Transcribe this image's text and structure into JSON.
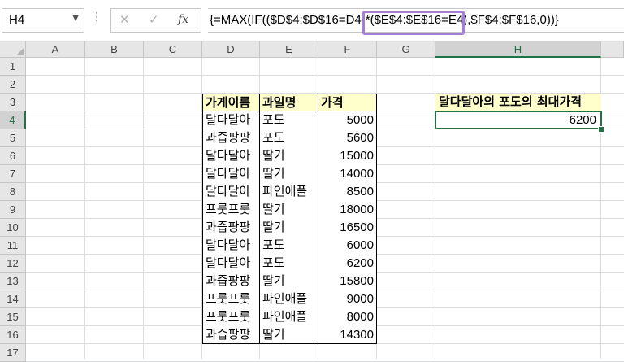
{
  "name_box": "H4",
  "formula_bar": {
    "dots": "⋮",
    "cancel_glyph": "✕",
    "enter_glyph": "✓",
    "fx_glyph": "fx",
    "formula": "{=MAX(IF(($D$4:$D$16=D4)*($E$4:$E$16=E4),$F$4:$F$16,0))}"
  },
  "columns": [
    "A",
    "B",
    "C",
    "D",
    "E",
    "F",
    "G",
    "H"
  ],
  "rows": [
    "1",
    "2",
    "3",
    "4",
    "5",
    "6",
    "7",
    "8",
    "9",
    "10",
    "11",
    "12",
    "13",
    "14",
    "15",
    "16",
    "17"
  ],
  "selected_cell": "H4",
  "table": {
    "headers": [
      "가게이름",
      "과일명",
      "가격"
    ],
    "rows": [
      [
        "달다달아",
        "포도",
        "5000"
      ],
      [
        "과즙팡팡",
        "포도",
        "5600"
      ],
      [
        "달다달아",
        "딸기",
        "15000"
      ],
      [
        "달다달아",
        "딸기",
        "14000"
      ],
      [
        "달다달아",
        "파인애플",
        "8500"
      ],
      [
        "프룻프룻",
        "딸기",
        "18000"
      ],
      [
        "과즙팡팡",
        "딸기",
        "16500"
      ],
      [
        "달다달아",
        "포도",
        "6000"
      ],
      [
        "달다달아",
        "포도",
        "6200"
      ],
      [
        "과즙팡팡",
        "딸기",
        "15800"
      ],
      [
        "프룻프룻",
        "파인애플",
        "9000"
      ],
      [
        "프룻프룻",
        "파인애플",
        "8000"
      ],
      [
        "과즙팡팡",
        "딸기",
        "14300"
      ]
    ]
  },
  "result": {
    "label": "달다달아의 포도의 최대가격",
    "value": "6200"
  },
  "colors": {
    "header_fill": "#ffffcc",
    "selection": "#217346",
    "highlight_box": "#a47dd7"
  }
}
